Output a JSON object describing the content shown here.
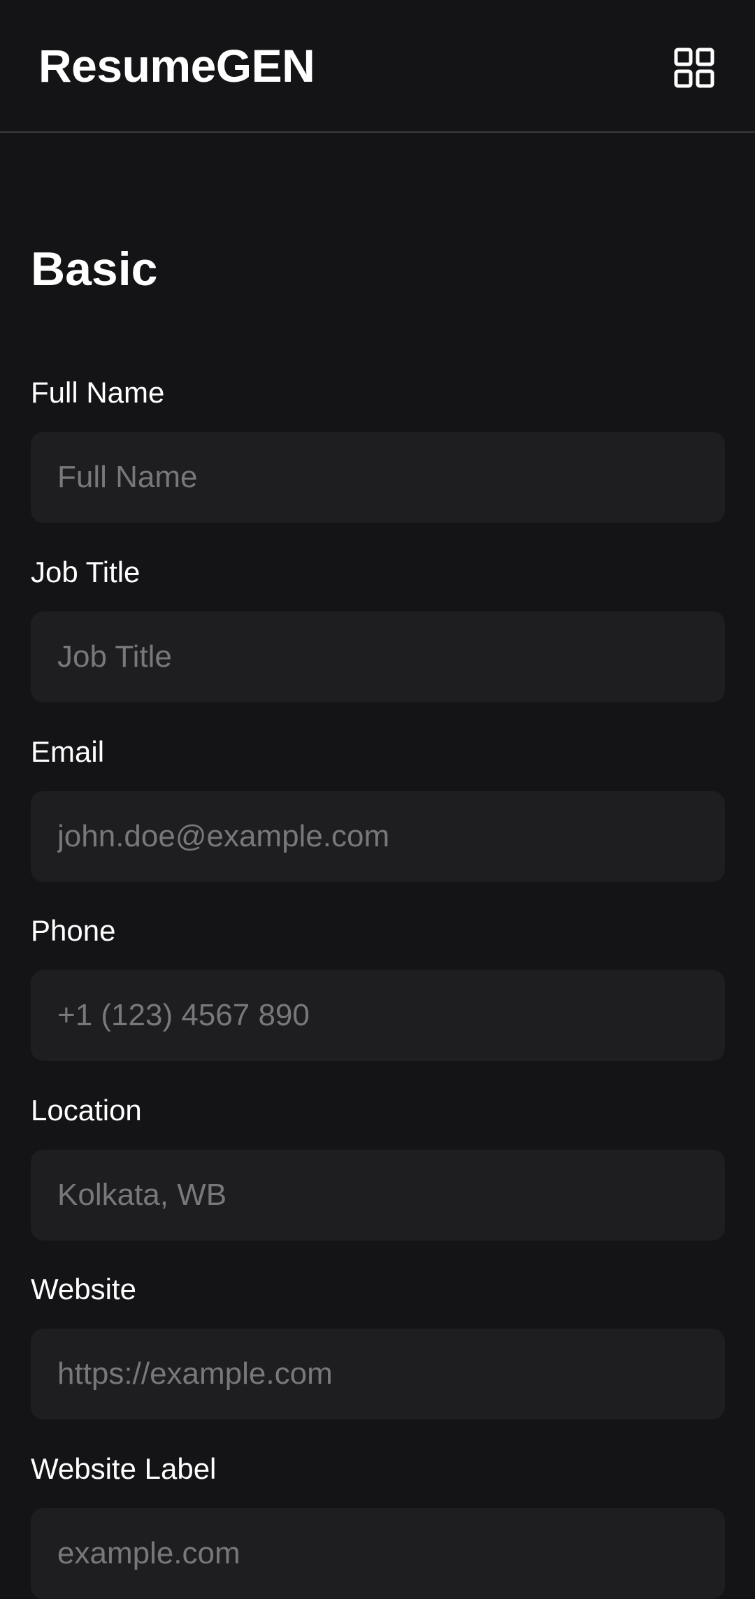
{
  "header": {
    "brand": "ResumeGEN",
    "menu_icon": "grid-icon"
  },
  "section": {
    "title": "Basic"
  },
  "fields": [
    {
      "label": "Full Name",
      "placeholder": "Full Name",
      "value": ""
    },
    {
      "label": "Job Title",
      "placeholder": "Job Title",
      "value": ""
    },
    {
      "label": "Email",
      "placeholder": "john.doe@example.com",
      "value": ""
    },
    {
      "label": "Phone",
      "placeholder": "+1 (123) 4567 890",
      "value": ""
    },
    {
      "label": "Location",
      "placeholder": "Kolkata, WB",
      "value": ""
    },
    {
      "label": "Website",
      "placeholder": "https://example.com",
      "value": ""
    },
    {
      "label": "Website Label",
      "placeholder": "example.com",
      "value": ""
    }
  ],
  "colors": {
    "background": "#141416",
    "input_background": "#1e1e21",
    "placeholder": "#77777c",
    "divider": "#3a3a3e",
    "text": "#ffffff"
  }
}
